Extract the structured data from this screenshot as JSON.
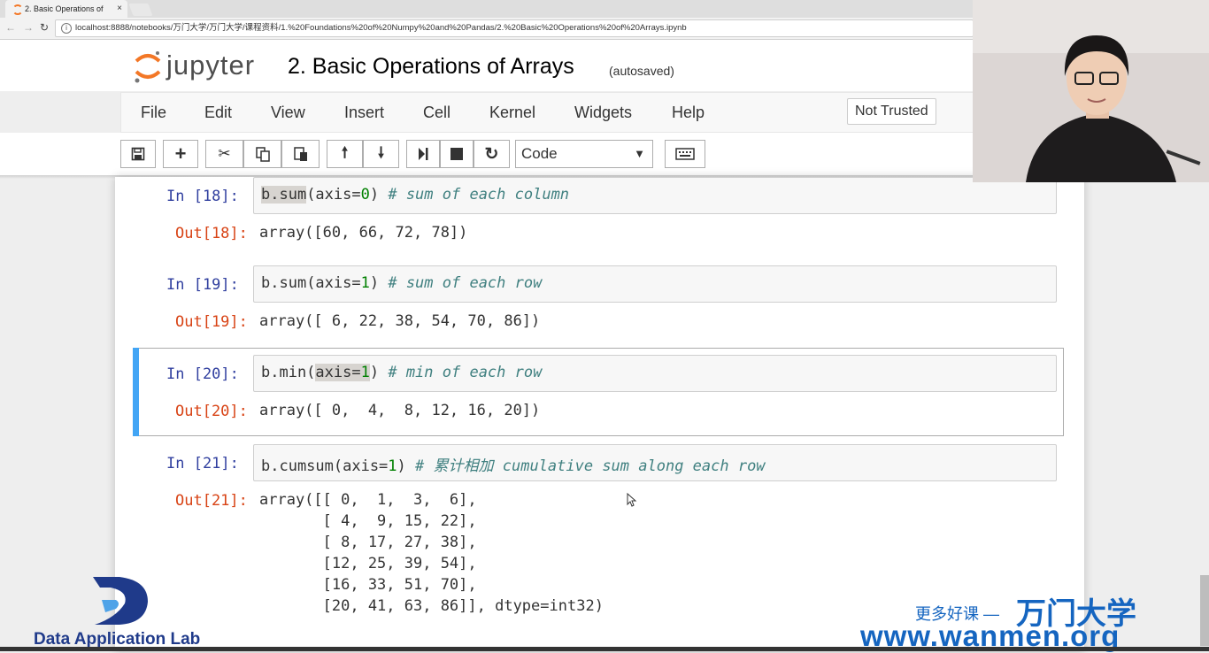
{
  "browser": {
    "tab_title": "2. Basic Operations of",
    "tab_close": "×",
    "url": "localhost:8888/notebooks/万门大学/万门大学/课程资料/1.%20Foundations%20of%20Numpy%20and%20Pandas/2.%20Basic%20Operations%20of%20Arrays.ipynb"
  },
  "header": {
    "logo_text": "jupyter",
    "notebook_title": "2. Basic Operations of Arrays",
    "autosave": "(autosaved)"
  },
  "menu": {
    "items": [
      "File",
      "Edit",
      "View",
      "Insert",
      "Cell",
      "Kernel",
      "Widgets",
      "Help"
    ],
    "trust": "Not Trusted"
  },
  "toolbar": {
    "cell_type": "Code",
    "icons": [
      "save-icon",
      "add-icon",
      "cut-icon",
      "copy-icon",
      "paste-icon",
      "move-up-icon",
      "move-down-icon",
      "run-icon",
      "stop-icon",
      "restart-icon",
      "keyboard-icon"
    ]
  },
  "cells": [
    {
      "in": "In  [18]:",
      "code": {
        "pre_hl": "b.sum",
        "hl": "",
        "mid": "(axis=",
        "num": "0",
        "post": ") ",
        "comment": "# sum of each column"
      },
      "out_prompt": "Out[18]:",
      "output": "array([60, 66, 72, 78])"
    },
    {
      "in": "In  [19]:",
      "code": {
        "pre_hl": "b.sum",
        "mid": "(axis=",
        "num": "1",
        "post": ") ",
        "comment": "# sum of each row"
      },
      "out_prompt": "Out[19]:",
      "output": "array([ 6, 22, 38, 54, 70, 86])"
    },
    {
      "in": "In  [20]:",
      "code": {
        "pre_hl": "b.min(",
        "mid": "axis=",
        "num": "1",
        "post": ") ",
        "comment": "# min of each row"
      },
      "out_prompt": "Out[20]:",
      "output": "array([ 0,  4,  8, 12, 16, 20])"
    },
    {
      "in": "In  [21]:",
      "code": {
        "pre_hl": "b.cumsum(axis=",
        "mid": "",
        "num": "1",
        "post": ") ",
        "comment": "# 累计相加 cumulative sum along each row"
      },
      "out_prompt": "Out[21]:",
      "output": "array([[ 0,  1,  3,  6],\n       [ 4,  9, 15, 22],\n       [ 8, 17, 27, 38],\n       [12, 25, 39, 54],\n       [16, 33, 51, 70],\n       [20, 41, 63, 86]], dtype=int32)"
    }
  ],
  "overlay": {
    "lab_name": "Data Application Lab",
    "promo": "更多好课 —",
    "brand": "万门大学",
    "site": "www.wanmen.org"
  },
  "colors": {
    "selected_bar": "#42a5f5",
    "in_prompt": "#303f9f",
    "out_prompt": "#d84315",
    "brand_blue": "#1565c0"
  }
}
